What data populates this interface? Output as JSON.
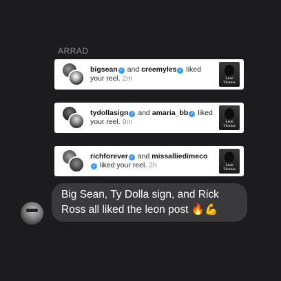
{
  "sender": {
    "name": "ARRAD"
  },
  "notifications": [
    {
      "user1": "bigsean",
      "user2": "creemyles",
      "and": "and",
      "action": "liked your",
      "line2": "reel.",
      "time": "2m",
      "thumb_text": "Leon\nThomas"
    },
    {
      "user1": "tydollasign",
      "user2": "amaria_bb",
      "and": "and",
      "action": "liked",
      "line2": "your reel.",
      "time": "9m",
      "thumb_text": "Leon\nThomas"
    },
    {
      "user1": "richforever",
      "user2": "missalliedimeco",
      "and": "and",
      "action": "",
      "line2": "liked your reel.",
      "time": "2h",
      "thumb_text": "Leon\nThomas"
    }
  ],
  "message": {
    "text": "Big Sean, Ty Dolla sign, and Rick Ross all liked the leon post 🔥💪"
  },
  "icons": {
    "verified": "verified-badge-icon"
  },
  "colors": {
    "background": "#1c1c1e",
    "bubble": "#3a3a3c",
    "verified": "#3897f0"
  }
}
